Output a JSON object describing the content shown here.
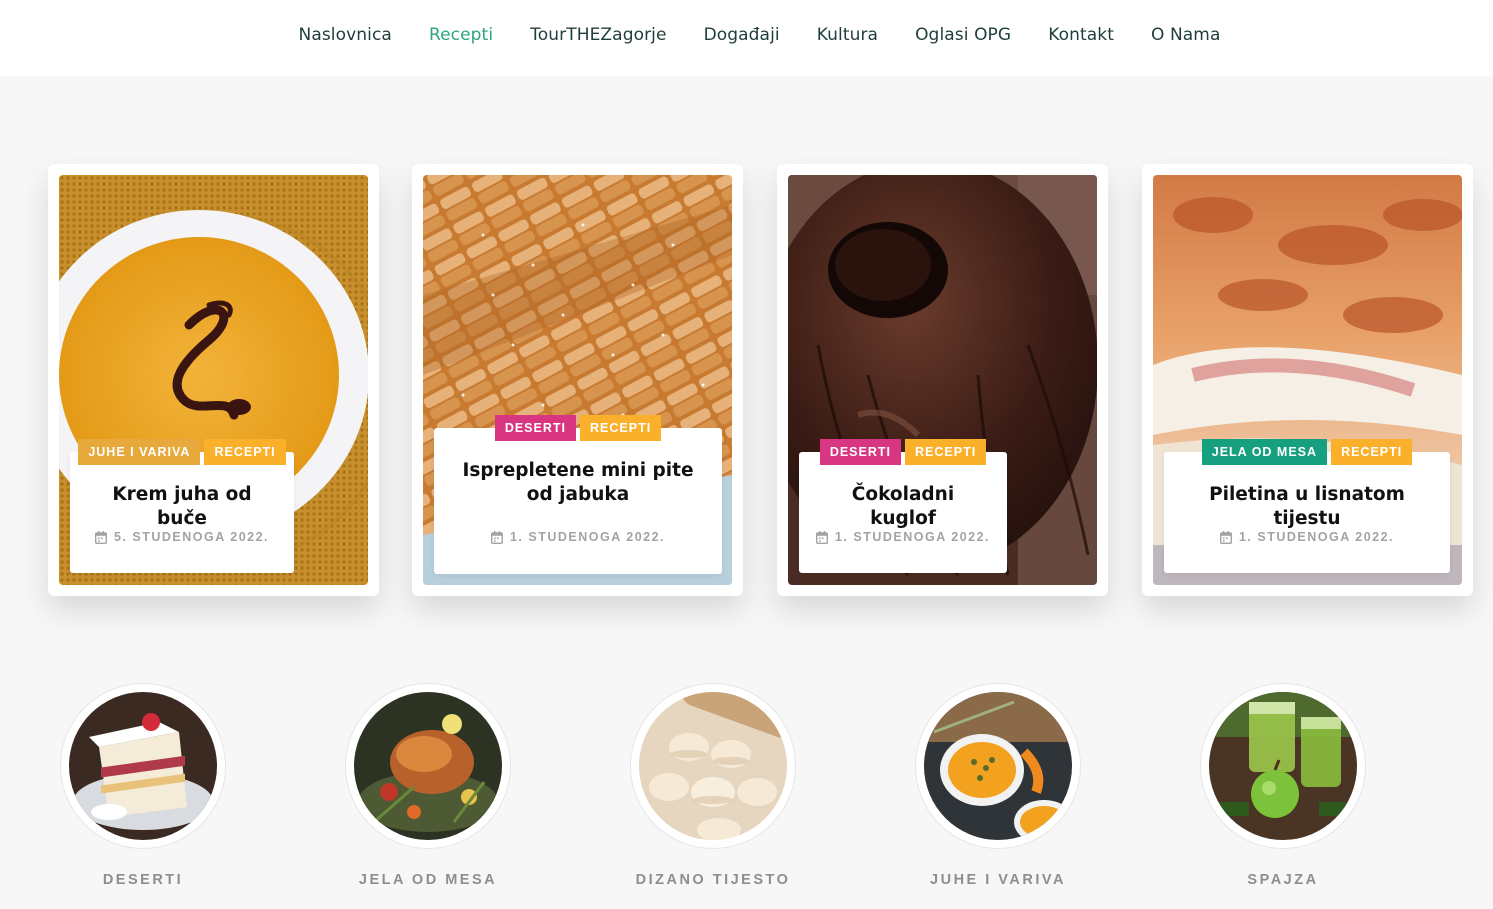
{
  "nav": {
    "items": [
      {
        "label": "Naslovnica"
      },
      {
        "label": "Recepti"
      },
      {
        "label": "TourTHEZagorje"
      },
      {
        "label": "Događaji"
      },
      {
        "label": "Kultura"
      },
      {
        "label": "Oglasi OPG"
      },
      {
        "label": "Kontakt"
      },
      {
        "label": "O Nama"
      }
    ],
    "active": "Recepti"
  },
  "cards": [
    {
      "tags": [
        "JUHE I VARIVA",
        "RECEPTI"
      ],
      "title": "Krem juha od buče",
      "date": "5. STUDENOGA 2022."
    },
    {
      "tags": [
        "DESERTI",
        "RECEPTI"
      ],
      "title": "Isprepletene mini pite od jabuka",
      "date": "1. STUDENOGA 2022."
    },
    {
      "tags": [
        "DESERTI",
        "RECEPTI"
      ],
      "title": "Čokoladni kuglof",
      "date": "1. STUDENOGA 2022."
    },
    {
      "tags": [
        "JELA OD MESA",
        "RECEPTI"
      ],
      "title": "Piletina u lisnatom tijestu",
      "date": "1. STUDENOGA 2022."
    }
  ],
  "categories": [
    {
      "label": "DESERTI"
    },
    {
      "label": "JELA OD MESA"
    },
    {
      "label": "DIZANO TIJESTO"
    },
    {
      "label": "JUHE I VARIVA"
    },
    {
      "label": "SPAJZA"
    }
  ],
  "colors": {
    "accent": "#2ba57e",
    "nav_text": "#1f3d3b",
    "tag_orange": "#fbb02c",
    "tag_gold": "#e8a93c",
    "tag_pink": "#d83680",
    "tag_teal": "#17a07f"
  }
}
